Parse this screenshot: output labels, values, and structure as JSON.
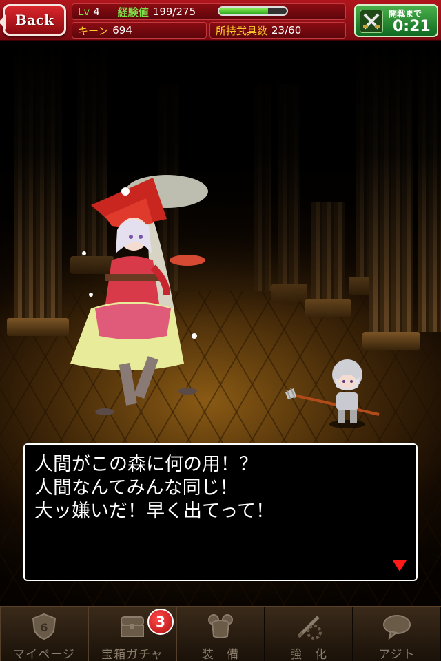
{
  "header": {
    "back_label": "Back",
    "level_label": "Lv",
    "level_value": "4",
    "exp_label": "経験値",
    "exp_value": "199/275",
    "exp_fraction": 0.72,
    "keen_label": "キーン",
    "keen_value": "694",
    "weapons_label": "所持武具数",
    "weapons_value": "23/60",
    "timer_label": "開戦まで",
    "timer_value": "0:21"
  },
  "dialog": {
    "lines": [
      "人間がこの森に何の用！？",
      "人間なんてみんな同じ！",
      "大ッ嫌いだ！早く出てって！"
    ]
  },
  "nav": {
    "items": [
      {
        "label": "マイページ",
        "icon": "shield-icon"
      },
      {
        "label": "宝箱ガチャ",
        "icon": "treasure-chest-icon"
      },
      {
        "label": "装　備",
        "icon": "armor-icon"
      },
      {
        "label": "強　化",
        "icon": "sword-crossed-icon"
      },
      {
        "label": "アジト",
        "icon": "speech-bubble-icon"
      }
    ],
    "gacha_badge": "3"
  },
  "colors": {
    "header_red": "#b0151c",
    "accent_gold": "#ffcc2a",
    "accent_green": "#7ee04a",
    "timer_green": "#2a9a35",
    "arrow_red": "#ff1a1a"
  }
}
